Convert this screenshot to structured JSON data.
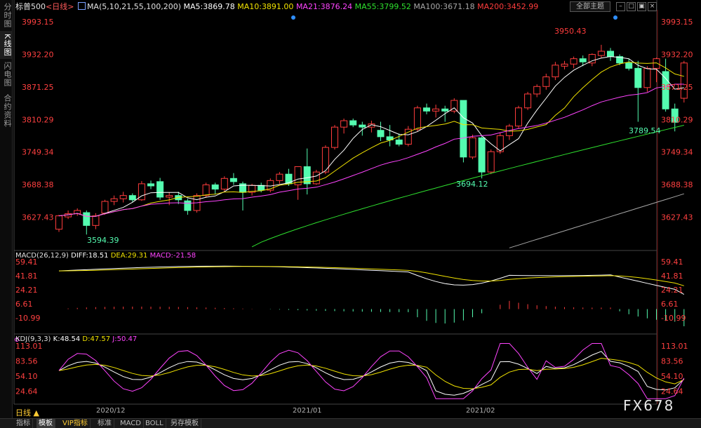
{
  "sidebar": {
    "tabs": [
      {
        "label": "分时图",
        "active": false
      },
      {
        "label": "K线图",
        "active": true
      },
      {
        "label": "闪电图",
        "active": false
      },
      {
        "label": "合约资料",
        "active": false
      }
    ]
  },
  "header": {
    "symbol": "标普500",
    "period": "<日线>",
    "ma_label": "MA(5,10,21,55,100,200)",
    "ma5": "MA5:3869.78",
    "ma10": "MA10:3891.00",
    "ma21": "MA21:3876.24",
    "ma55": "MA55:3799.52",
    "ma100": "MA100:3671.18",
    "ma200": "MA200:3452.99",
    "theme_button": "全部主题"
  },
  "colors": {
    "up": "#ff3c3c",
    "down": "#54fcb0",
    "ma5": "#ffffff",
    "ma10": "#f0e200",
    "ma21": "#ff44ff",
    "ma55": "#2ee02e",
    "ma100": "#a8a8a8",
    "ma200": "#ff3c3c",
    "axis": "#ff4040"
  },
  "price_axis": [
    "3993.15",
    "3932.20",
    "3871.25",
    "3810.29",
    "3749.34",
    "3688.38",
    "3627.43"
  ],
  "annotations": {
    "high": "3950.43",
    "low1": "3594.39",
    "low2": "3694.12",
    "low3": "3789.54"
  },
  "macd": {
    "label": "MACD(26,12,9)",
    "diff": "DIFF:18.51",
    "dea": "DEA:29.31",
    "macd": "MACD:-21.58",
    "axis": [
      "59.41",
      "41.81",
      "24.21",
      "6.61",
      "-10.99"
    ]
  },
  "kdj": {
    "label": "KDJ(9,3,3)",
    "k": "K:48.54",
    "d": "D:47.57",
    "j": "J:50.47",
    "axis": [
      "113.01",
      "83.56",
      "54.10",
      "24.64"
    ]
  },
  "date_axis": [
    "2020/12",
    "2021/01",
    "2021/02"
  ],
  "bottom": {
    "period_label": "日线 ▲",
    "tabs": [
      "指标",
      "模板",
      "VIP指标",
      "标准",
      "MACD",
      "BOLL",
      "另存模板"
    ]
  },
  "watermark": "FX678",
  "chart_data": {
    "type": "candlestick",
    "ohlc": [
      [
        3605,
        3632,
        3600,
        3630
      ],
      [
        3628,
        3640,
        3624,
        3634
      ],
      [
        3634,
        3644,
        3630,
        3640
      ],
      [
        3636,
        3640,
        3595,
        3612
      ],
      [
        3612,
        3635,
        3605,
        3630
      ],
      [
        3635,
        3660,
        3632,
        3657
      ],
      [
        3657,
        3668,
        3650,
        3662
      ],
      [
        3662,
        3675,
        3655,
        3668
      ],
      [
        3668,
        3672,
        3656,
        3660
      ],
      [
        3660,
        3695,
        3658,
        3690
      ],
      [
        3690,
        3696,
        3680,
        3686
      ],
      [
        3694,
        3701,
        3660,
        3665
      ],
      [
        3665,
        3674,
        3650,
        3668
      ],
      [
        3668,
        3675,
        3652,
        3660
      ],
      [
        3658,
        3662,
        3632,
        3640
      ],
      [
        3640,
        3672,
        3636,
        3668
      ],
      [
        3668,
        3692,
        3664,
        3688
      ],
      [
        3688,
        3692,
        3670,
        3680
      ],
      [
        3680,
        3704,
        3676,
        3700
      ],
      [
        3700,
        3710,
        3688,
        3694
      ],
      [
        3690,
        3694,
        3640,
        3674
      ],
      [
        3674,
        3690,
        3668,
        3687
      ],
      [
        3687,
        3692,
        3674,
        3678
      ],
      [
        3678,
        3700,
        3674,
        3696
      ],
      [
        3696,
        3712,
        3690,
        3708
      ],
      [
        3708,
        3718,
        3686,
        3690
      ],
      [
        3688,
        3710,
        3660,
        3722
      ],
      [
        3722,
        3756,
        3670,
        3690
      ],
      [
        3690,
        3716,
        3688,
        3712
      ],
      [
        3712,
        3762,
        3708,
        3758
      ],
      [
        3758,
        3800,
        3754,
        3796
      ],
      [
        3796,
        3812,
        3784,
        3808
      ],
      [
        3808,
        3812,
        3796,
        3800
      ],
      [
        3800,
        3806,
        3780,
        3796
      ],
      [
        3796,
        3808,
        3786,
        3802
      ],
      [
        3790,
        3806,
        3770,
        3778
      ],
      [
        3778,
        3800,
        3760,
        3772
      ],
      [
        3772,
        3784,
        3760,
        3764
      ],
      [
        3764,
        3798,
        3760,
        3792
      ],
      [
        3792,
        3836,
        3788,
        3832
      ],
      [
        3832,
        3840,
        3820,
        3826
      ],
      [
        3826,
        3838,
        3814,
        3830
      ],
      [
        3830,
        3836,
        3806,
        3826
      ],
      [
        3826,
        3850,
        3822,
        3846
      ],
      [
        3846,
        3842,
        3730,
        3740
      ],
      [
        3740,
        3782,
        3736,
        3776
      ],
      [
        3776,
        3780,
        3700,
        3712
      ],
      [
        3712,
        3754,
        3708,
        3750
      ],
      [
        3750,
        3786,
        3746,
        3780
      ],
      [
        3780,
        3802,
        3772,
        3798
      ],
      [
        3798,
        3836,
        3794,
        3832
      ],
      [
        3832,
        3862,
        3828,
        3858
      ],
      [
        3858,
        3876,
        3852,
        3872
      ],
      [
        3872,
        3896,
        3866,
        3890
      ],
      [
        3890,
        3918,
        3884,
        3912
      ],
      [
        3910,
        3920,
        3904,
        3914
      ],
      [
        3914,
        3928,
        3906,
        3924
      ],
      [
        3924,
        3930,
        3910,
        3918
      ],
      [
        3916,
        3934,
        3910,
        3932
      ],
      [
        3930,
        3950,
        3926,
        3938
      ],
      [
        3938,
        3944,
        3920,
        3928
      ],
      [
        3928,
        3932,
        3912,
        3916
      ],
      [
        3916,
        3924,
        3902,
        3906
      ],
      [
        3906,
        3920,
        3806,
        3870
      ],
      [
        3870,
        3910,
        3862,
        3906
      ],
      [
        3906,
        3926,
        3880,
        3924
      ],
      [
        3900,
        3924,
        3825,
        3830
      ],
      [
        3830,
        3840,
        3788,
        3805
      ],
      [
        3850,
        3920,
        3842,
        3916
      ]
    ],
    "ma5_end": 3869.78,
    "ma10_end": 3891.0,
    "ma21_end": 3876.24,
    "ma55_end": 3799.52,
    "ma100_end": 3671.18,
    "ma200_end": 3452.99,
    "macd_diff_end": 18.51,
    "macd_dea_end": 29.31,
    "macd_hist_end": -21.58,
    "kdj_k_end": 48.54,
    "kdj_d_end": 47.57,
    "kdj_j_end": 50.47
  }
}
